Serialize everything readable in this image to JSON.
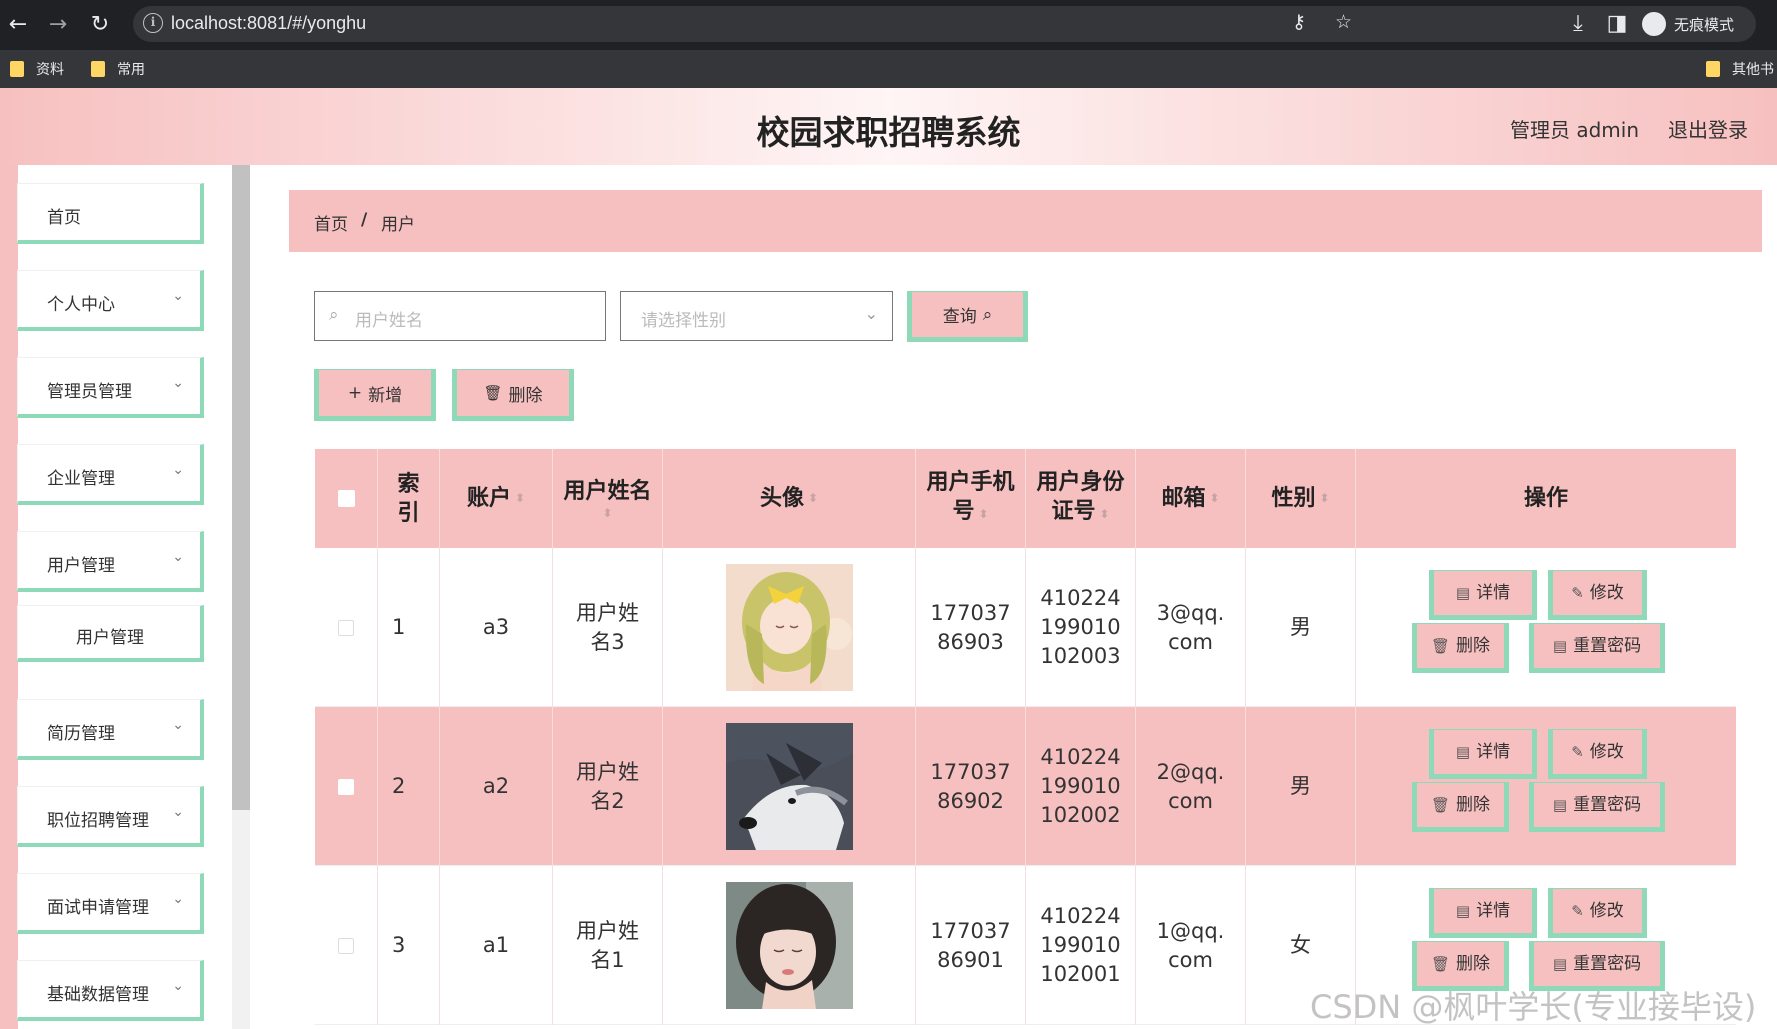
{
  "browser": {
    "url": "localhost:8081/#/yonghu",
    "incognito_label": "无痕模式",
    "bookmarks": [
      "资料",
      "常用"
    ],
    "other_bookmarks": "其他书"
  },
  "header": {
    "title": "校园求职招聘系统",
    "user": "管理员 admin",
    "logout": "退出登录"
  },
  "sidebar": {
    "items": [
      {
        "label": "首页",
        "expandable": false
      },
      {
        "label": "个人中心",
        "expandable": true
      },
      {
        "label": "管理员管理",
        "expandable": true
      },
      {
        "label": "企业管理",
        "expandable": true
      },
      {
        "label": "用户管理",
        "expandable": true
      },
      {
        "label": "用户管理",
        "expandable": false,
        "sub": true
      },
      {
        "label": "简历管理",
        "expandable": true
      },
      {
        "label": "职位招聘管理",
        "expandable": true
      },
      {
        "label": "面试申请管理",
        "expandable": true
      },
      {
        "label": "基础数据管理",
        "expandable": true
      }
    ]
  },
  "breadcrumb": {
    "home": "首页",
    "sep": "/",
    "current": "用户"
  },
  "search": {
    "name_placeholder": "用户姓名",
    "gender_placeholder": "请选择性别",
    "query_label": "查询"
  },
  "actions": {
    "add_label": "新增",
    "delete_label": "删除"
  },
  "table": {
    "headers": {
      "index": "索引",
      "account": "账户",
      "name": "用户姓名",
      "avatar": "头像",
      "phone": "用户手机号",
      "idcard": "用户身份证号",
      "email": "邮箱",
      "gender": "性别",
      "ops": "操作"
    },
    "op_labels": {
      "detail": "详情",
      "edit": "修改",
      "delete": "删除",
      "reset": "重置密码"
    },
    "rows": [
      {
        "index": "1",
        "account": "a3",
        "name": "用户姓名3",
        "avatar": "anime-girl",
        "phone": "17703786903",
        "idcard": "410224199010102003",
        "email": "3@qq.com",
        "gender": "男"
      },
      {
        "index": "2",
        "account": "a2",
        "name": "用户姓名2",
        "avatar": "husky-dog",
        "phone": "17703786902",
        "idcard": "410224199010102002",
        "email": "2@qq.com",
        "gender": "男"
      },
      {
        "index": "3",
        "account": "a1",
        "name": "用户姓名1",
        "avatar": "girl-photo",
        "phone": "17703786901",
        "idcard": "410224199010102001",
        "email": "1@qq.com",
        "gender": "女"
      }
    ]
  },
  "watermark": "CSDN @枫叶学长(专业接毕设)",
  "colors": {
    "accent_pink": "#f7c0c0",
    "accent_green": "#8ed9b8"
  }
}
